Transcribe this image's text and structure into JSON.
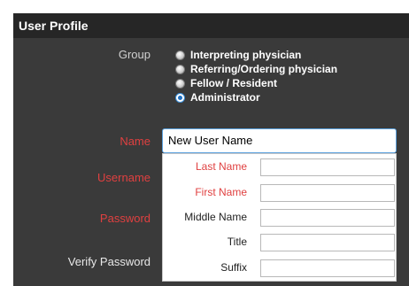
{
  "panel": {
    "title": "User Profile"
  },
  "group": {
    "label": "Group",
    "options": [
      {
        "label": "Interpreting physician",
        "checked": false
      },
      {
        "label": "Referring/Ordering physician",
        "checked": false
      },
      {
        "label": "Fellow / Resident",
        "checked": false
      },
      {
        "label": "Administrator",
        "checked": true
      }
    ]
  },
  "fields": {
    "name_label": "Name",
    "name_value": "New User Name",
    "username_label": "Username",
    "password_label": "Password",
    "verify_password_label": "Verify Password"
  },
  "name_popup": {
    "last_name_label": "Last Name",
    "first_name_label": "First Name",
    "middle_name_label": "Middle Name",
    "title_label": "Title",
    "suffix_label": "Suffix"
  },
  "colors": {
    "required_label": "#e04040",
    "header_bg": "#262626",
    "focus_border": "#5aa0dd"
  }
}
